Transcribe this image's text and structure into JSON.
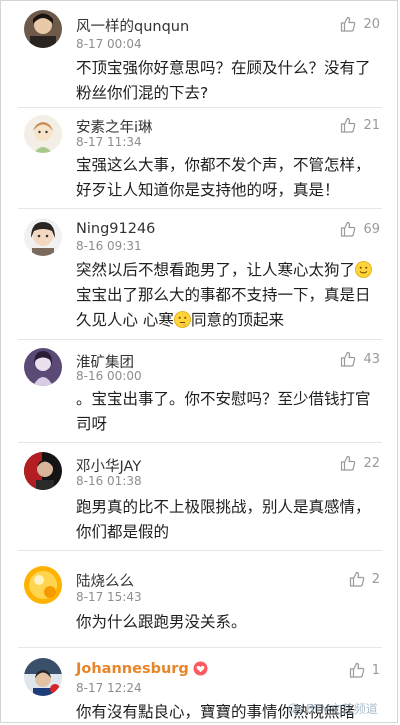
{
  "comments": [
    {
      "username": "风一样的qunqun",
      "time": "8-17 00:04",
      "likes": "20",
      "text": "不顶宝强你好意思吗？在顾及什么？没有了粉丝你们混的下去?"
    },
    {
      "username": "安素之年i琳",
      "time": "8-17 11:34",
      "likes": "21",
      "text": "宝强这么大事，你都不发个声，不管怎样，好歹让人知道你是支持他的呀，真是！"
    },
    {
      "username": "Ning91246",
      "time": "8-16 09:31",
      "likes": "69",
      "text_1": "突然以后不想看跑男了，让人寒心太狗了",
      "text_2": "宝宝出了那么大的事都不支持一下，真是日久见人心  心寒",
      "text_3": "同意的顶起来"
    },
    {
      "username": "淮矿集团",
      "time": "8-16 00:00",
      "likes": "43",
      "text": "。宝宝出事了。你不安慰吗？至少借钱打官司呀"
    },
    {
      "username": "邓小华JAY",
      "time": "8-16 01:38",
      "likes": "22",
      "text": "跑男真的比不上极限挑战，别人是真感情，你们都是假的"
    },
    {
      "username": "陆烧么么",
      "time": "8-17 15:43",
      "likes": "2",
      "text": "你为什么跟跑男没关系。"
    },
    {
      "username": "Johannesburg",
      "time": "8-17 12:24",
      "likes": "1",
      "text": "你有沒有點良心，寶寶的事情你熟視無睹"
    }
  ],
  "icons": {
    "like": "thumbs-up-icon",
    "emoji": "smiley-emoji-icon",
    "badge": "heart-badge-icon",
    "watermark": "wechat-icon"
  },
  "watermark": {
    "text": "BTV文艺频道"
  },
  "colors": {
    "background": "#ffffff",
    "divider": "#e6e6e6",
    "time": "#8d8d8d",
    "username_special": "#e8852a"
  }
}
